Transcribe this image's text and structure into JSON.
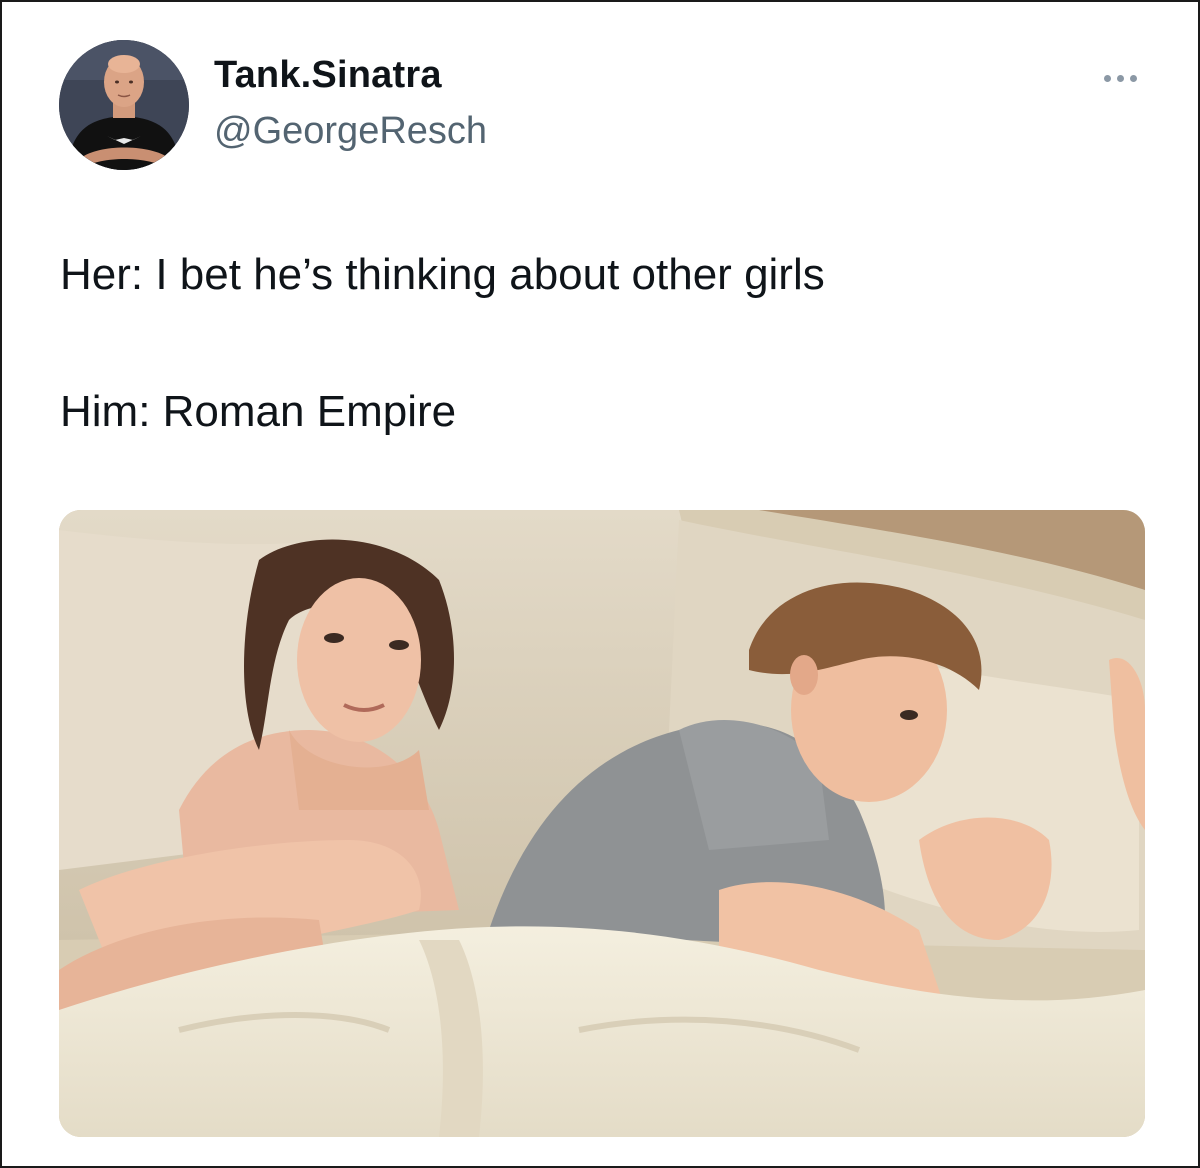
{
  "tweet": {
    "display_name": "Tank.Sinatra",
    "handle": "@GeorgeResch",
    "more_icon": "more-horizontal-icon",
    "text_lines": [
      "Her: I bet he’s thinking about other girls",
      "Him: Roman Empire"
    ],
    "media": {
      "kind": "photo",
      "subject": "couple-in-bed"
    }
  },
  "colors": {
    "text_primary": "#0f1419",
    "text_secondary": "#536471",
    "more_dots": "#8b98a5"
  }
}
